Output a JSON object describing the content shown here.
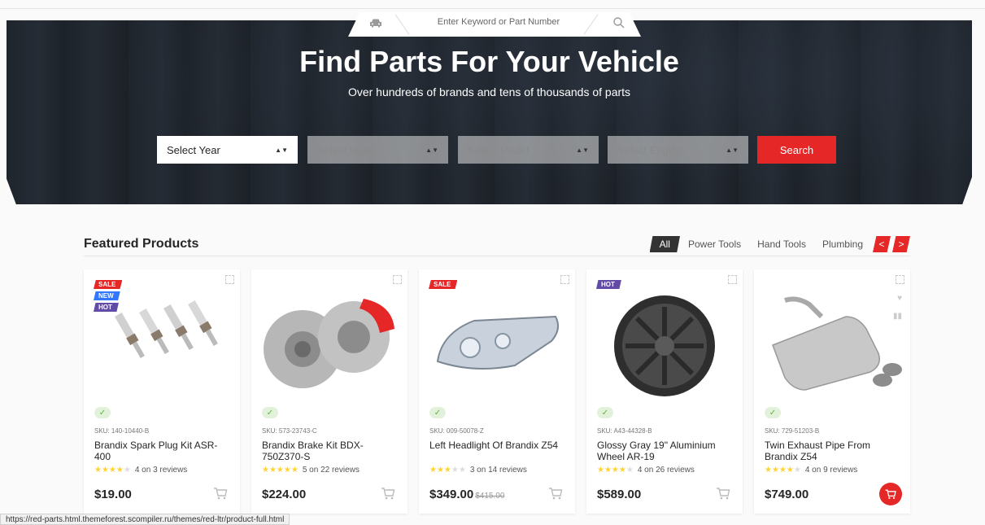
{
  "search": {
    "keyword_placeholder": "Enter Keyword or Part Number"
  },
  "hero": {
    "title": "Find Parts For Your Vehicle",
    "subtitle": "Over hundreds of brands and tens of thousands of parts",
    "selects": [
      "Select Year",
      "Select Make",
      "Select Model",
      "Select Engine"
    ],
    "search_label": "Search"
  },
  "featured": {
    "title": "Featured Products",
    "filters": [
      "All",
      "Power Tools",
      "Hand Tools",
      "Plumbing"
    ],
    "prev_label": "<",
    "next_label": ">"
  },
  "products": [
    {
      "name": "Brandix Spark Plug Kit ASR-400",
      "sku": "SKU: 140-10440-B",
      "rating": 4,
      "reviews": "4 on 3 reviews",
      "price": "$19.00",
      "old_price": "",
      "badges": [
        "SALE",
        "NEW",
        "HOT"
      ]
    },
    {
      "name": "Brandix Brake Kit BDX-750Z370-S",
      "sku": "SKU: 573-23743-C",
      "rating": 5,
      "reviews": "5 on 22 reviews",
      "price": "$224.00",
      "old_price": "",
      "badges": []
    },
    {
      "name": "Left Headlight Of Brandix Z54",
      "sku": "SKU: 009-50078-Z",
      "rating": 3,
      "reviews": "3 on 14 reviews",
      "price": "$349.00",
      "old_price": "$415.00",
      "badges": [
        "SALE"
      ]
    },
    {
      "name": "Glossy Gray 19\" Aluminium Wheel AR-19",
      "sku": "SKU: A43-44328-B",
      "rating": 4,
      "reviews": "4 on 26 reviews",
      "price": "$589.00",
      "old_price": "",
      "badges": [
        "HOT"
      ]
    },
    {
      "name": "Twin Exhaust Pipe From Brandix Z54",
      "sku": "SKU: 729-51203-B",
      "rating": 4,
      "reviews": "4 on 9 reviews",
      "price": "$749.00",
      "old_price": "",
      "badges": []
    }
  ],
  "status_bar": "https://red-parts.html.themeforest.scompiler.ru/themes/red-ltr/product-full.html",
  "colors": {
    "accent": "#e52727",
    "sale": "#e52727",
    "new": "#3377ff",
    "hot": "#614ba6",
    "star": "#ffd333"
  }
}
